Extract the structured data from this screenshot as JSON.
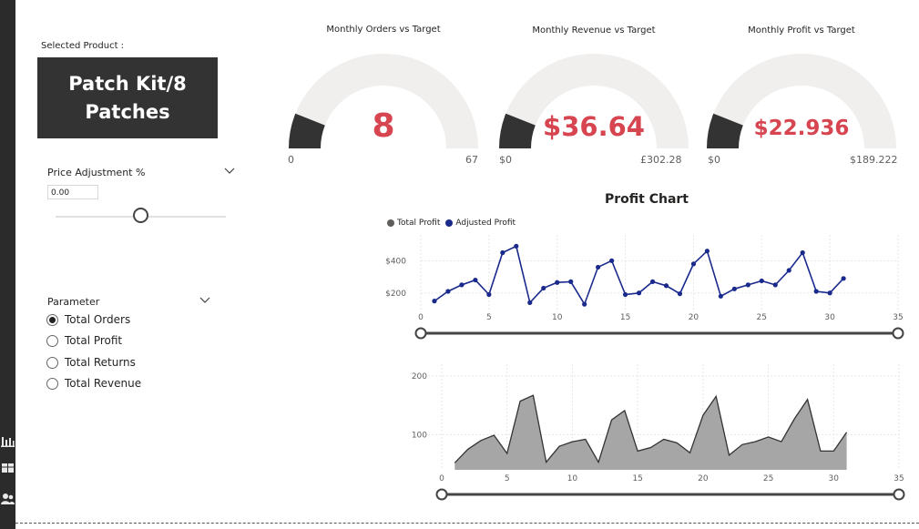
{
  "selected_product": {
    "label": "Selected Product :",
    "line1": "Patch Kit/8",
    "line2": "Patches"
  },
  "price_adjustment": {
    "title": "Price Adjustment %",
    "value": "0.00",
    "slider_fraction": 0.5
  },
  "parameter": {
    "title": "Parameter",
    "options": [
      "Total Orders",
      "Total Profit",
      "Total Returns",
      "Total Revenue"
    ],
    "selected_index": 0
  },
  "gauges": [
    {
      "title": "Monthly Orders vs Target",
      "value": "8",
      "min": "0",
      "max": "67",
      "fill_fraction": 0.12
    },
    {
      "title": "Monthly Revenue vs Target",
      "value": "$36.64",
      "min": "$0",
      "max": "£302.28",
      "fill_fraction": 0.12
    },
    {
      "title": "Monthly Profit vs Target",
      "value": "$22.936",
      "min": "$0",
      "max": "$189.222",
      "fill_fraction": 0.12
    }
  ],
  "colors": {
    "accent_red": "#d64550",
    "navy": "#1a2a8c",
    "dark": "#333333",
    "gauge_track": "#f0efee",
    "area_fill": "#a6a6a6"
  },
  "chart_data": [
    {
      "type": "line",
      "title": "Profit Chart",
      "legend": [
        "Total Profit",
        "Adjusted Profit"
      ],
      "legend_colors": [
        "#605e5c",
        "#1a2a8c"
      ],
      "x": [
        1,
        2,
        3,
        4,
        5,
        6,
        7,
        8,
        9,
        10,
        11,
        12,
        13,
        14,
        15,
        16,
        17,
        18,
        19,
        20,
        21,
        22,
        23,
        24,
        25,
        26,
        27,
        28,
        29,
        30,
        31
      ],
      "series": [
        {
          "name": "Adjusted Profit",
          "values": [
            150,
            210,
            250,
            280,
            190,
            450,
            490,
            140,
            230,
            265,
            270,
            130,
            360,
            400,
            190,
            200,
            270,
            245,
            195,
            380,
            460,
            180,
            225,
            250,
            275,
            250,
            340,
            450,
            210,
            200,
            290
          ]
        }
      ],
      "ytick_labels": [
        "$400",
        "$200"
      ],
      "ytick_values": [
        400,
        200
      ],
      "xticks": [
        0,
        5,
        10,
        15,
        20,
        25,
        30,
        35
      ],
      "xlim": [
        0,
        35
      ],
      "ylim": [
        80,
        560
      ],
      "grid": true
    },
    {
      "type": "area",
      "x": [
        1,
        2,
        3,
        4,
        5,
        6,
        7,
        8,
        9,
        10,
        11,
        12,
        13,
        14,
        15,
        16,
        17,
        18,
        19,
        20,
        21,
        22,
        23,
        24,
        25,
        26,
        27,
        28,
        29,
        30,
        31
      ],
      "values": [
        52,
        75,
        90,
        99,
        68,
        157,
        167,
        53,
        80,
        88,
        92,
        53,
        125,
        141,
        72,
        78,
        92,
        86,
        69,
        133,
        165,
        65,
        83,
        88,
        96,
        88,
        127,
        160,
        72,
        72,
        104
      ],
      "yticks": [
        200,
        100
      ],
      "xticks": [
        0,
        5,
        10,
        15,
        20,
        25,
        30,
        35
      ],
      "xlim": [
        0,
        35
      ],
      "ylim": [
        40,
        220
      ],
      "grid": true
    }
  ]
}
